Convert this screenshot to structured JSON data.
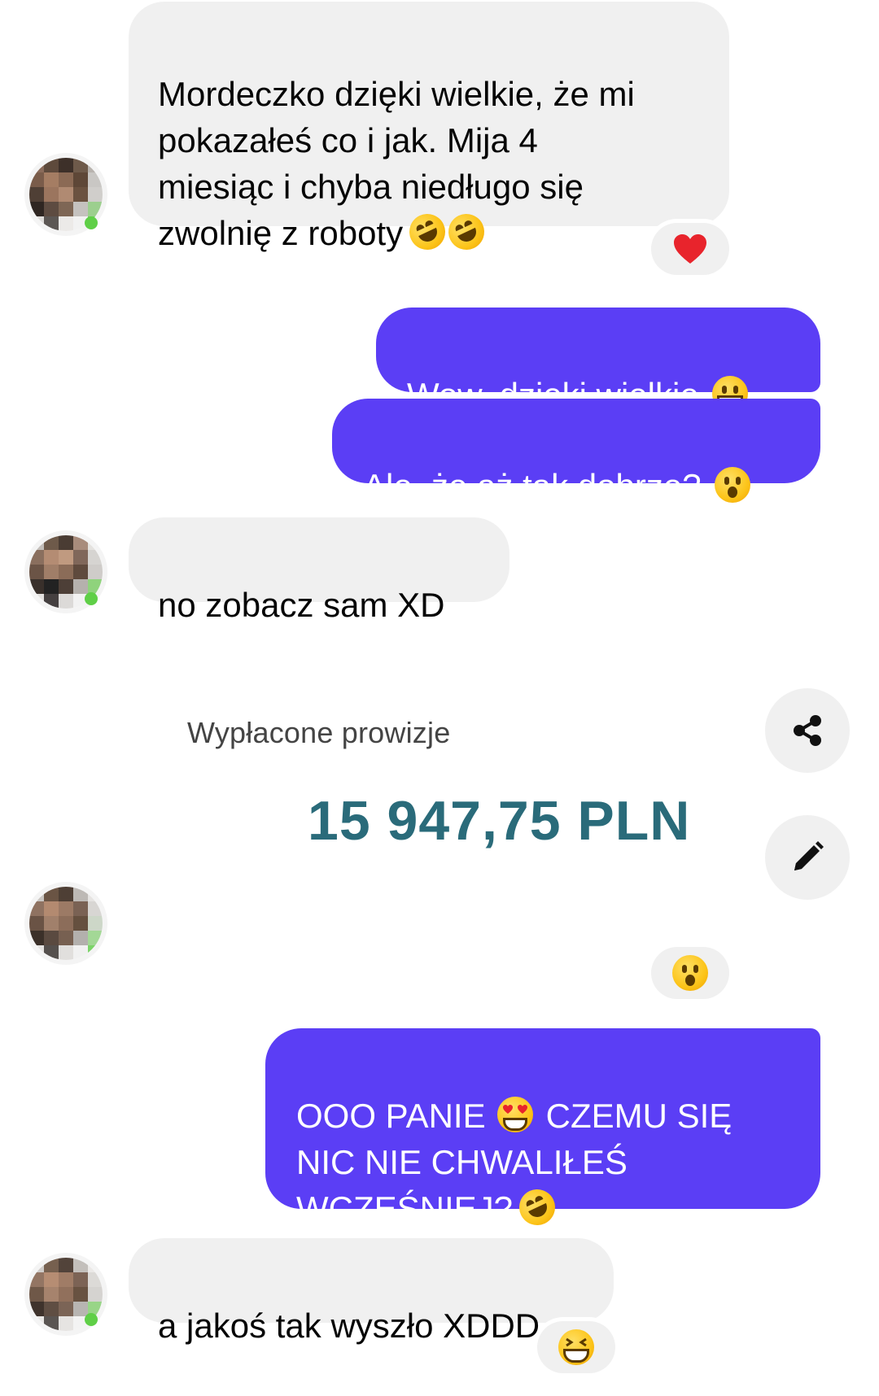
{
  "messages": [
    {
      "side": "incoming",
      "text": "Mordeczko dzięki wielkie, że mi\npokazałeś co i jak. Mija 4\nmiesiąc i chyba niedługo się\nzwolnię z roboty"
    },
    {
      "side": "outgoing",
      "text": "Wow, dzięki wielkie"
    },
    {
      "side": "outgoing",
      "text": "Ale, że aż tak dobrze?"
    },
    {
      "side": "incoming",
      "text": "no zobacz sam XD"
    },
    {
      "side": "outgoing",
      "text": "OOO PANIE"
    },
    {
      "side": "outgoing",
      "text": "CZEMU SIĘ\nNIC NIE CHWALIŁEŚ\nWCZEŚNIEJ?"
    },
    {
      "side": "incoming",
      "text": "a jakoś tak wyszło XDDD"
    }
  ],
  "reactions": {
    "msg1": "heart",
    "shared_image": "astonished-face",
    "msg_last": "grinning-squinting-face"
  },
  "shared_image": {
    "label": "Wypłacone prowizje",
    "value": "15 947,75 PLN"
  },
  "colors": {
    "outgoing_bubble": "#5b3ef5",
    "incoming_bubble": "#f0f0f0",
    "amount": "#2a6b7a"
  }
}
